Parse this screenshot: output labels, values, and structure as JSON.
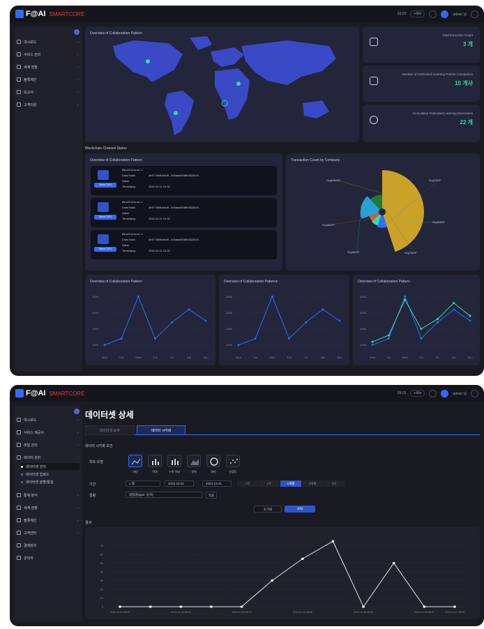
{
  "app": {
    "logo": "F@AI",
    "brand_suffix": "SMARTCORE",
    "accent": "#2f6bff",
    "kpi_color": "#2de0a5"
  },
  "topbar": {
    "time": "59:23",
    "extend_label": "+Min",
    "user_name": "admin 님"
  },
  "screen1": {
    "sidebar": {
      "items": [
        "대시보드",
        "서비스 관리",
        "세계 현황",
        "블록체인",
        "보고서",
        "고객지원"
      ]
    },
    "map": {
      "title": "Overview of Collaboration Pattern"
    },
    "kpis": [
      {
        "label": "Total Execution Count",
        "value": "3 개",
        "icon": "database-icon"
      },
      {
        "label": "Number of Federated Learning Partner Companies",
        "value": "15 개사",
        "icon": "building-icon"
      },
      {
        "label": "Cumulative Federated Learning Executions",
        "value": "22 개",
        "icon": "globe-icon"
      }
    ],
    "blockchain": {
      "title": "Blockchain Channel Status",
      "tx_title": "Overview of Collaboration Pattern",
      "transactions": [
        {
          "block": "BlockTxCount: 1",
          "hash": "5e97748f1fe6d0...6c9aba5548b5822b1e...",
          "time": "2024.12.11 12:30",
          "badge": "Block-7423"
        },
        {
          "block": "BlockTxCount: 1",
          "hash": "5e97748f1fe6d0...6c9aba5548b5822b1e...",
          "time": "2024.12.11 12:30",
          "badge": "Block-7423"
        },
        {
          "block": "BlockTxCount: 1",
          "hash": "5e97748f1fe6d0...6c9aba5548b5822b1e...",
          "time": "2024.12.11 12:30",
          "badge": "Block-7423"
        }
      ],
      "labels": {
        "hash": "Data Hash",
        "value": "Value",
        "timestamp": "Timestamp"
      },
      "pie_title": "Transaction Count by Company",
      "pie_labels": [
        "OrgA9MSP",
        "Org1MSP",
        "Org6MSP",
        "Org3MSP",
        "Org2MSP",
        "Org7MSP"
      ]
    },
    "bottom_charts": {
      "title_1": "Overview of Collaboration Pattern",
      "title_2": "Overview of Collaboration Patterns",
      "title_3": "Overview of Collaboration Pattern",
      "x_labels": [
        "Mon",
        "Tue",
        "Wed",
        "Thu",
        "Fri",
        "Sat",
        "Sun"
      ]
    }
  },
  "screen2": {
    "sidebar": {
      "items": [
        "대시보드",
        "서비스 제공사",
        "파일 관리",
        "데이터 관리",
        "통계 분석",
        "세계 현황",
        "블록체인",
        "고객센터",
        "결재관리",
        "관리자"
      ],
      "subitems": [
        "데이터셋 관리",
        "데이터셋 업로드",
        "데이터셋 분할/통합"
      ]
    },
    "page_title": "데이터셋 상세",
    "tabs": [
      "데이터셋 요약",
      "데이터 시각화"
    ],
    "filter_title": "데이터 시각화 조건",
    "chart_type_label": "차트 유형",
    "chart_types": [
      "라인",
      "막대",
      "누적 막대",
      "영역",
      "파이",
      "산점도"
    ],
    "period_label": "기간",
    "period_select": "1 월",
    "date_from": "2023-10-01",
    "date_to": "2023-12-31",
    "period_buttons": [
      "1일",
      "1주",
      "1개월",
      "3개월",
      "1년"
    ],
    "column_label": "컬럼",
    "column_select": "컬럼명(type: 숫자)",
    "apply_label": "적용",
    "reset_label": "초기화",
    "search_label": "조회",
    "result_label": "결과"
  },
  "chart_data": [
    {
      "type": "line",
      "title": "Overview of Collaboration Pattern",
      "x": [
        "Mon",
        "Tue",
        "Wed",
        "Thu",
        "Fri",
        "Sat",
        "Sun"
      ],
      "series": [
        {
          "values": [
            1000,
            1200,
            2500,
            1200,
            1700,
            2100,
            1750
          ]
        }
      ]
    },
    {
      "type": "line",
      "title": "Overview of Collaboration Patterns",
      "x": [
        "Mon",
        "Tue",
        "Wed",
        "Thu",
        "Fri",
        "Sat",
        "Sun"
      ],
      "series": [
        {
          "values": [
            1000,
            1200,
            2500,
            1200,
            1700,
            2100,
            1750
          ]
        }
      ]
    },
    {
      "type": "line",
      "title": "Overview of Collaboration Pattern",
      "x": [
        "Mon",
        "Tue",
        "Wed",
        "Thu",
        "Fri",
        "Sat",
        "Sun"
      ],
      "series": [
        {
          "values": [
            1000,
            1200,
            2500,
            1200,
            1700,
            2100,
            1750
          ]
        },
        {
          "values": [
            1100,
            1300,
            2400,
            1500,
            1800,
            2300,
            1900
          ]
        }
      ]
    },
    {
      "type": "pie",
      "title": "Transaction Count by Company",
      "categories": [
        "OrgA9MSP",
        "Org1MSP",
        "Org6MSP",
        "Org3MSP",
        "Org2MSP",
        "Org7MSP"
      ],
      "values": [
        45,
        10,
        8,
        7,
        18,
        12
      ]
    },
    {
      "type": "line",
      "title": "결과",
      "x": [
        "2023-10-01 08:00",
        "2023-10-08 08:00",
        "2023-10-15 08:00",
        "2023-10-22 08:00",
        "2023-10-29 08:00",
        "2023-11-05 08:00",
        "2023-11-12 08:00",
        "2023-11-19 08:00",
        "2023-11-26 08:00",
        "2023-12-03 08:00",
        "2023-12-10 08:00",
        "2023-12-17 08:00"
      ],
      "series": [
        {
          "values": [
            0,
            0,
            0,
            0,
            0,
            30,
            55,
            75,
            0,
            50,
            0,
            0
          ]
        }
      ],
      "ylim": [
        0,
        80
      ]
    }
  ]
}
